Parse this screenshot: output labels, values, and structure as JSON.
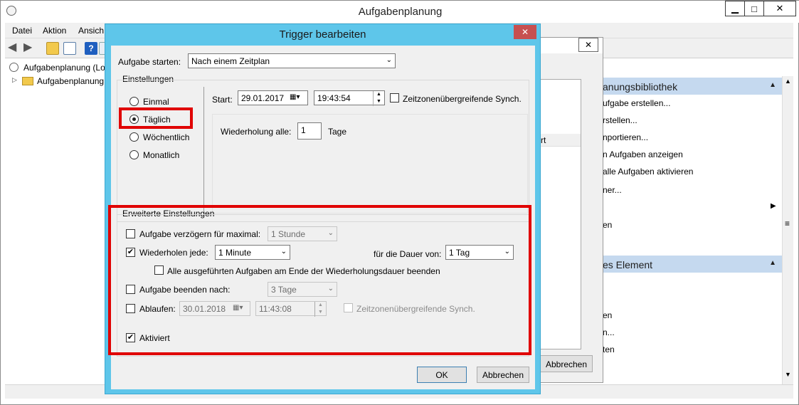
{
  "main": {
    "title": "Aufgabenplanung",
    "menu": [
      "Datei",
      "Aktion",
      "Ansich"
    ],
    "tree": {
      "root": "Aufgabenplanung (Lo",
      "child": "Aufgabenplanung"
    },
    "actions": {
      "section1": "anungsbibliothek",
      "items1": [
        "ufgabe erstellen...",
        "rstellen...",
        "nportieren...",
        "n Aufgaben anzeigen",
        "alle Aufgaben aktivieren",
        "ner...",
        "",
        "en"
      ],
      "section2": "es Element",
      "items2": [
        "en",
        "n...",
        "ten"
      ]
    }
  },
  "bg_dialog": {
    "column_partial": "rt",
    "cancel_label": "Abbrechen"
  },
  "trigger": {
    "title": "Trigger bearbeiten",
    "start_task_label": "Aufgabe starten:",
    "start_task_value": "Nach einem Zeitplan",
    "settings_label": "Einstellungen",
    "schedule_options": [
      "Einmal",
      "Täglich",
      "Wöchentlich",
      "Monatlich"
    ],
    "selected_option": "Täglich",
    "start_label": "Start:",
    "start_date": "29.01.2017",
    "start_time": "19:43:54",
    "sync_label": "Zeitzonenübergreifende Synch.",
    "repeat_every_label": "Wiederholung alle:",
    "repeat_every_value": "1",
    "days_label": "Tage",
    "advanced_label": "Erweiterte Einstellungen",
    "delay_label": "Aufgabe verzögern für maximal:",
    "delay_value": "1 Stunde",
    "repeat_label": "Wiederholen jede:",
    "repeat_value": "1 Minute",
    "duration_label": "für die Dauer von:",
    "duration_value": "1 Tag",
    "stop_all_label": "Alle ausgeführten Aufgaben am Ende der Wiederholungsdauer beenden",
    "stop_after_label": "Aufgabe beenden nach:",
    "stop_after_value": "3 Tage",
    "expire_label": "Ablaufen:",
    "expire_date": "30.01.2018",
    "expire_time": "11:43:08",
    "expire_sync_label": "Zeitzonenübergreifende Synch.",
    "enabled_label": "Aktiviert",
    "ok_label": "OK",
    "cancel_label": "Abbrechen",
    "check_mark": "✔",
    "highlight_color": "#e00000"
  }
}
